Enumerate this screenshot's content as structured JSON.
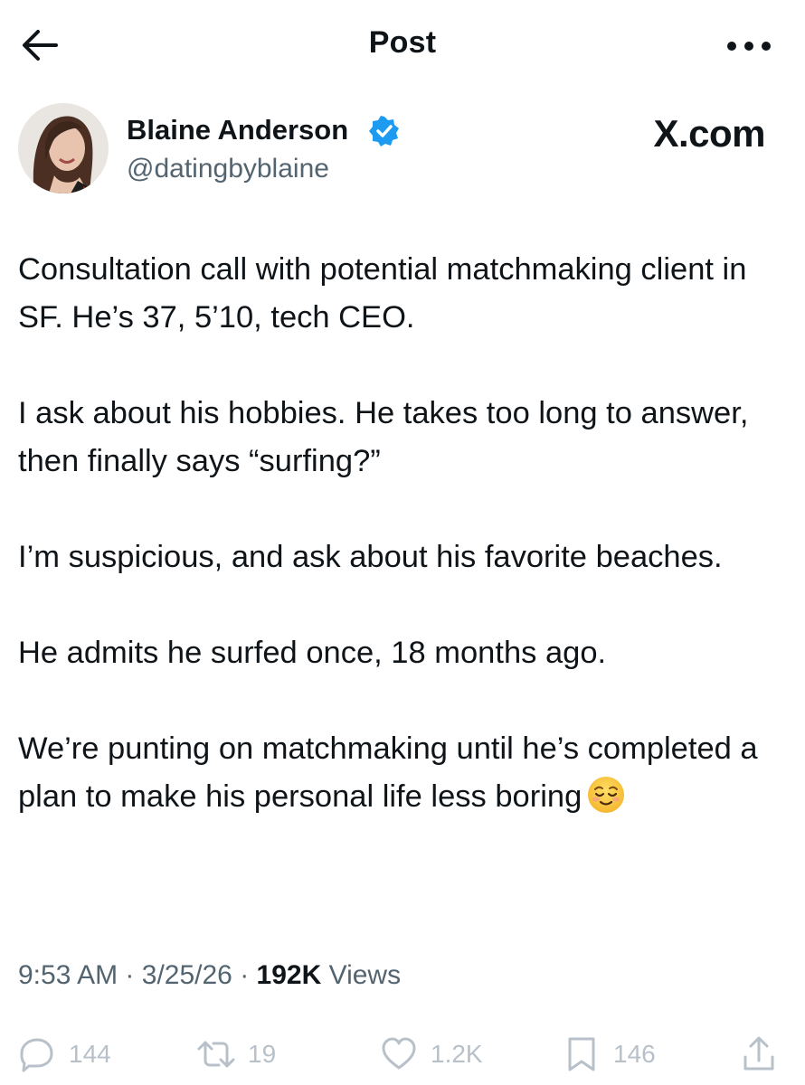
{
  "header": {
    "title": "Post",
    "back_icon": "arrow-left-icon",
    "more_icon": "more-horizontal-icon"
  },
  "author": {
    "name": "Blaine Anderson",
    "handle": "@datingbyblaine",
    "verified_color": "#1d9bf0"
  },
  "watermark": "X.com",
  "post": {
    "paragraphs": [
      "Consultation call with potential matchmaking client in SF. He’s 37, 5’10, tech CEO.",
      "I ask about his hobbies. He takes too long to answer, then finally says “surfing?”",
      "I’m suspicious, and ask about his favorite beaches.",
      "He admits he surfed once, 18 months ago.",
      "We’re punting on matchmaking until he’s completed a plan to make his personal life less boring"
    ],
    "emoji": "relieved-face"
  },
  "meta": {
    "time": "9:53 AM",
    "date": "3/25/26",
    "views_count": "192K",
    "views_label": "Views",
    "separator": "·"
  },
  "actions": {
    "replies": "144",
    "reposts": "19",
    "likes": "1.2K",
    "bookmarks": "146"
  }
}
